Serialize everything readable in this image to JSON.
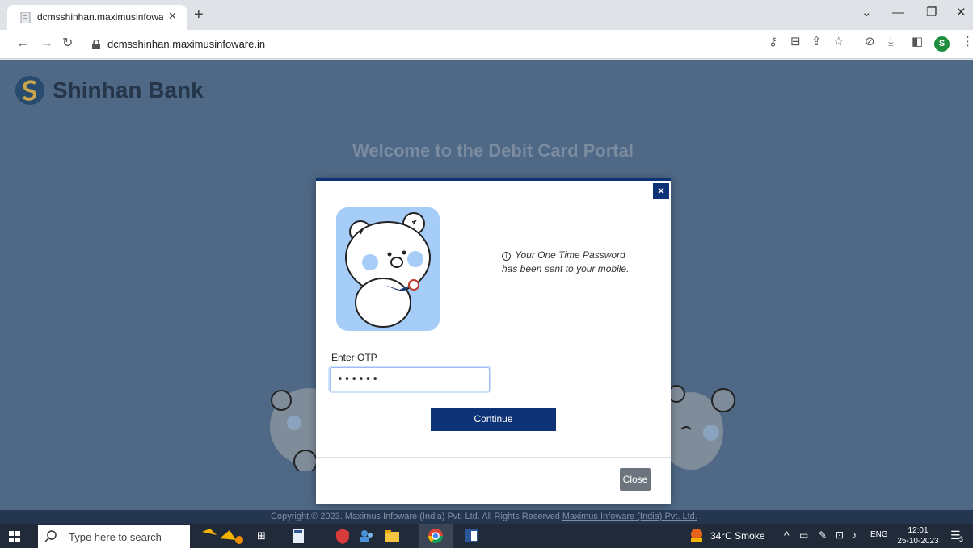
{
  "browser": {
    "tab_title": "dcmsshinhan.maximusinfoware.in",
    "url": "dcmsshinhan.maximusinfoware.in",
    "profile_initial": "S"
  },
  "page": {
    "bank_name": "Shinhan Bank",
    "welcome_title": "Welcome to the Debit Card Portal",
    "footer_text": "Copyright © 2023. Maximus Infoware (India) Pvt. Ltd. All Rights Reserved ",
    "footer_link": "Maximus Infoware (India) Pvt. Ltd.",
    "footer_suffix": " ."
  },
  "modal": {
    "close_x": "×",
    "info_icon": "i",
    "info_text": "Your One Time Password has been sent to your mobile.",
    "otp_label": "Enter OTP",
    "otp_value": "••••••",
    "continue_label": "Continue",
    "close_label": "Close"
  },
  "taskbar": {
    "search_placeholder": "Type here to search",
    "weather": "34°C  Smoke",
    "language": "ENG",
    "time": "12:01",
    "date": "25-10-2023",
    "notification_count": "3"
  },
  "colors": {
    "brand_navy": "#0d3275",
    "page_background": "#4e6886",
    "bear_card": "#a6cdf7"
  }
}
